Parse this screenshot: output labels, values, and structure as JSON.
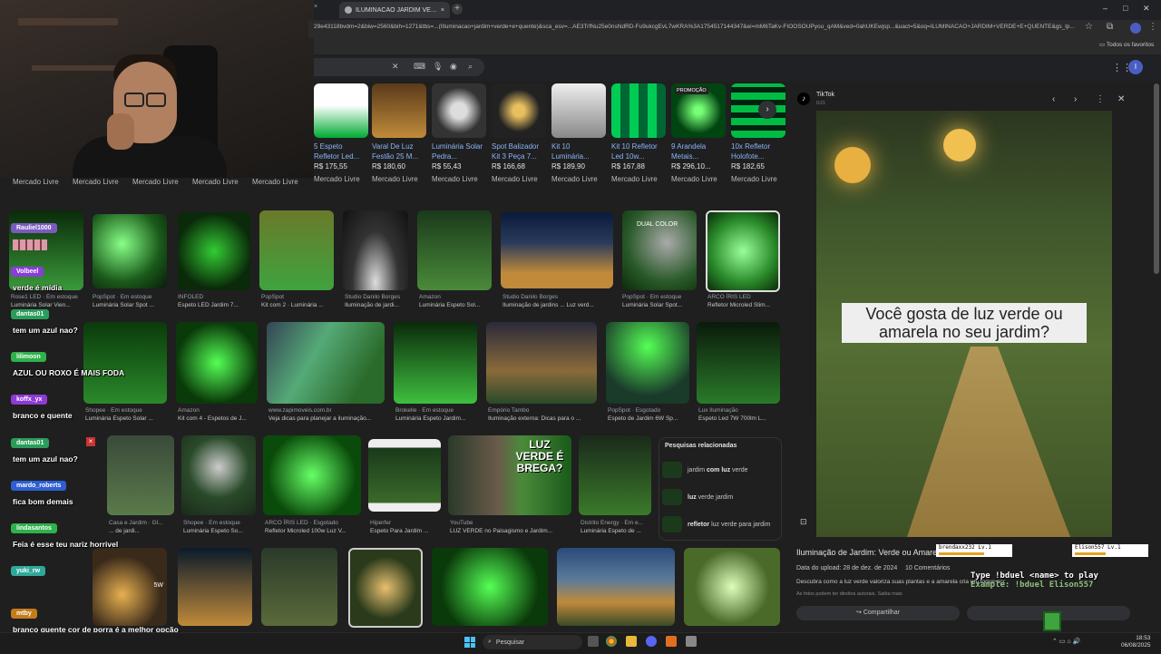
{
  "browser": {
    "tab_title": "ILUMINACAO JARDIM VERDE E",
    "tab_close": "×",
    "new_tab": "+",
    "url": "29e43118bvdm=2&biw=2560&bih=1271&tbs=...(IIluminacao+jardim+verde+e+quente)&sca_esv=...AE3TrfNu25e0nsNdRD-Fu9ukcgEvL7wKRA%3A1754517144347&ei=mM6TaKv-FIOOSOUPyou_qAM&ved=0ahUKEwjsp...&uact=5&oq=ILUMINACAO+JARDIM+VERDE+E+QUENTE&gs_lp...",
    "all_favorites": "Todos os favoritos",
    "window_controls": [
      "–",
      "□",
      "✕"
    ]
  },
  "shopping": {
    "items": [
      {
        "title": "5 Espeto Refletor Led...",
        "price": "R$ 175,55",
        "store": "Mercado Livre",
        "badge": ""
      },
      {
        "title": "Varal De Luz Festão 25 M...",
        "price": "R$ 180,60",
        "store": "Mercado Livre",
        "badge": ""
      },
      {
        "title": "Luminária Solar Pedra...",
        "price": "R$ 55,43",
        "store": "Mercado Livre",
        "badge": ""
      },
      {
        "title": "Spot Balizador Kit 3 Peça 7...",
        "price": "R$ 166,68",
        "store": "Mercado Livre",
        "badge": ""
      },
      {
        "title": "Kit 10 Luminária...",
        "price": "R$ 189,90",
        "store": "Mercado Livre",
        "badge": ""
      },
      {
        "title": "Kit 10 Refletor Led 10w...",
        "price": "R$ 167,88",
        "store": "Mercado Livre",
        "badge": ""
      },
      {
        "title": "9 Arandela Metais...",
        "price": "R$ 296,10...",
        "store": "Mercado Livre",
        "badge": "PROMOÇÃO"
      },
      {
        "title": "10x Refletor Holofote...",
        "price": "R$ 182,65",
        "store": "Mercado Livre",
        "badge": ""
      }
    ],
    "left_stores": [
      "Mercado Livre",
      "Mercado Livre",
      "Mercado Livre",
      "Mercado Livre",
      "Mercado Livre"
    ],
    "next": "›"
  },
  "grid": {
    "row1": [
      {
        "src": "Rose1 LED · Em estoque",
        "title": "Luminária Solar Vien..."
      },
      {
        "src": "PopSpot · Em estoque",
        "title": "Luminária Solar Spot ..."
      },
      {
        "src": "INFOLED",
        "title": "Espeto LED Jardim 7..."
      },
      {
        "src": "PopSpot",
        "title": "Kit com 2 · Luminária ..."
      },
      {
        "src": "Studio Danilo Borges",
        "title": "Iluminação de jardi..."
      },
      {
        "src": "Amazon",
        "title": "Luminária Espeto Sol..."
      },
      {
        "src": "Studio Danilo Borges",
        "title": "Iluminação de jardins ... Luz verd..."
      },
      {
        "src": "PopSpot · Em estoque",
        "title": "Luminária Solar Spot..."
      },
      {
        "src": "ARCO ÍRIS LED",
        "title": "Refletor Microled Slim..."
      }
    ],
    "row2": [
      {
        "src": "Shopee · Em estoque",
        "title": "Luminária Espeto Solar ..."
      },
      {
        "src": "Amazon",
        "title": "Kit com 4 - Espetos de J..."
      },
      {
        "src": "www.zapimoveis.com.br",
        "title": "Veja dicas para planejar a iluminação..."
      },
      {
        "src": "Brokelle · Em estoque",
        "title": "Luminária Espeto Jardim..."
      },
      {
        "src": "Empório Tambo",
        "title": "Iluminação externa: Dicas para o ..."
      },
      {
        "src": "PopSpot · Esgotado",
        "title": "Espeto de Jardim 6W Sp..."
      },
      {
        "src": "Lux Iluminação",
        "title": "Espeto Led 7W 700lm L..."
      }
    ],
    "row3": [
      {
        "src": "Casa e Jardim · Gl...",
        "title": "... de jardi..."
      },
      {
        "src": "Shopee · Em estoque",
        "title": "Luminária Espeto So..."
      },
      {
        "src": "ARCO ÍRIS LED · Esgotado",
        "title": "Refletor Microled 100w Luz V..."
      },
      {
        "src": "Hiperfer",
        "title": "Espeto Para Jardim ..."
      },
      {
        "src": "YouTube",
        "title": "LUZ VERDE no Paisagismo e Jardim..."
      },
      {
        "src": "Distrito Energy · Em e...",
        "title": "Luminária Espeto de ..."
      }
    ],
    "dual_color": "DUAL COLOR",
    "luz_verde_overlay": "LUZ VERDE É BREGA?",
    "sw_badge": "5W"
  },
  "related": {
    "title": "Pesquisas relacionadas",
    "items": [
      {
        "pre": "jardim ",
        "bold": "com luz",
        "post": " verde"
      },
      {
        "pre": "",
        "bold": "luz",
        "post": " verde jardim"
      },
      {
        "pre": "",
        "bold": "refletor",
        "post": " luz verde para jardim"
      }
    ]
  },
  "preview": {
    "source": "TikTok",
    "source_sub": "0:21",
    "image_caption": "Você gosta de luz verde ou amarela no seu jardim?",
    "title": "Iluminação de Jardim: Verde ou Amarela?",
    "upload": "Data do upload: 28 de dez. de 2024",
    "comments": "10 Comentários",
    "description": "Descubra como a luz verde valoriza suas plantas e a amarela cria um toque aconchegante no jardim.",
    "copyright": "As fotos podem ter direitos autorais. Saiba mais",
    "share": "Compartilhar",
    "nav_prev": "‹",
    "nav_next": "›",
    "more": "⋮",
    "close": "✕"
  },
  "chat": [
    {
      "user": "Rauliel1000",
      "msg": "",
      "color": "#7a5bbd"
    },
    {
      "user": "Volbeel",
      "msg": "verde é mídia",
      "color": "#8b3dd9"
    },
    {
      "user": "dantas01",
      "msg": "tem um azul nao?",
      "color": "#2a9d5a"
    },
    {
      "user": "lilimoon",
      "msg": "AZUL OU ROXO É MAIS FODA",
      "color": "#2fb14b"
    },
    {
      "user": "koffx_yx",
      "msg": "branco e quente",
      "color": "#8e3ad4"
    },
    {
      "user": "dantas01",
      "msg": "tem um azul nao?",
      "color": "#2a9d5a"
    },
    {
      "user": "mardo_roberts",
      "msg": "fica bom demais",
      "color": "#2d5fd1"
    },
    {
      "user": "lindasantos",
      "msg": "Feia é esse teu nariz horrivel",
      "color": "#2fb14b"
    },
    {
      "user": "yuki_rw",
      "msg": "",
      "color": "#2fa89a"
    },
    {
      "user": "mtby",
      "msg": "branco quente cor de porra é a melhor opção",
      "color": "#c47b1a"
    }
  ],
  "stream_game": {
    "player1": "brendaxx232",
    "player1_lvl": "Lv.1",
    "player2": "Elison557",
    "player2_lvl": "Lv.1",
    "type_line": "Type !bduel <name> to play",
    "example_line": "Example: !bduel Elison557"
  },
  "taskbar": {
    "search": "Pesquisar",
    "time": "18:53",
    "date": "06/08/2025"
  },
  "colors": {
    "accent": "#8ab4f8",
    "stock": "#81c995",
    "bg": "#1f1f1f"
  }
}
